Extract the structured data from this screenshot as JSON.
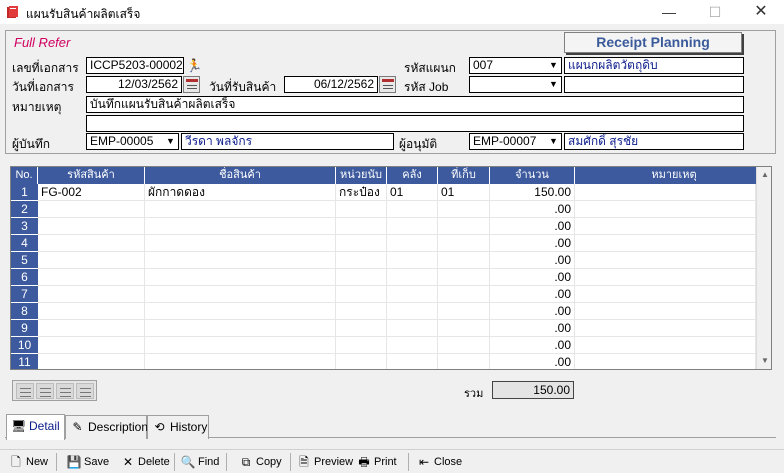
{
  "window": {
    "title": "แผนรับสินค้าผลิตเสร็จ"
  },
  "form": {
    "mode_label": "Full Refer",
    "planning_button": "Receipt Planning",
    "doc_no_label": "เลขที่เอกสาร",
    "doc_no": "ICCP5203-00002",
    "department_label": "รหัสแผนก",
    "department_code": "007",
    "department_name": "แผนกผลิตวัตถุดิบ",
    "doc_date_label": "วันที่เอกสาร",
    "doc_date": "12/03/2562",
    "receive_date_label": "วันที่รับสินค้า",
    "receive_date": "06/12/2562",
    "job_label": "รหัส Job",
    "job_code": "",
    "job_name": "",
    "remark_label": "หมายเหตุ",
    "remark_line1": "บันทึกแผนรับสินค้าผลิตเสร็จ",
    "remark_line2": "",
    "recorder_label": "ผู้บันทึก",
    "recorder_code": "EMP-00005",
    "recorder_name": "วีรดา พลจักร",
    "approver_label": "ผู้อนุมัติ",
    "approver_code": "EMP-00007",
    "approver_name": "สมศักดิ์ สุรชัย"
  },
  "grid": {
    "columns": [
      "No.",
      "รหัสสินค้า",
      "ชื่อสินค้า",
      "หน่วยนับ",
      "คลัง",
      "ที่เก็บ",
      "จำนวน",
      "หมายเหตุ"
    ],
    "rows": [
      {
        "no": "1",
        "code": "FG-002",
        "name": "ผักกาดดอง",
        "unit": "กระป๋อง",
        "wh": "01",
        "loc": "01",
        "qty": "150.00",
        "note": ""
      },
      {
        "no": "2",
        "code": "",
        "name": "",
        "unit": "",
        "wh": "",
        "loc": "",
        "qty": ".00",
        "note": ""
      },
      {
        "no": "3",
        "code": "",
        "name": "",
        "unit": "",
        "wh": "",
        "loc": "",
        "qty": ".00",
        "note": ""
      },
      {
        "no": "4",
        "code": "",
        "name": "",
        "unit": "",
        "wh": "",
        "loc": "",
        "qty": ".00",
        "note": ""
      },
      {
        "no": "5",
        "code": "",
        "name": "",
        "unit": "",
        "wh": "",
        "loc": "",
        "qty": ".00",
        "note": ""
      },
      {
        "no": "6",
        "code": "",
        "name": "",
        "unit": "",
        "wh": "",
        "loc": "",
        "qty": ".00",
        "note": ""
      },
      {
        "no": "7",
        "code": "",
        "name": "",
        "unit": "",
        "wh": "",
        "loc": "",
        "qty": ".00",
        "note": ""
      },
      {
        "no": "8",
        "code": "",
        "name": "",
        "unit": "",
        "wh": "",
        "loc": "",
        "qty": ".00",
        "note": ""
      },
      {
        "no": "9",
        "code": "",
        "name": "",
        "unit": "",
        "wh": "",
        "loc": "",
        "qty": ".00",
        "note": ""
      },
      {
        "no": "10",
        "code": "",
        "name": "",
        "unit": "",
        "wh": "",
        "loc": "",
        "qty": ".00",
        "note": ""
      },
      {
        "no": "11",
        "code": "",
        "name": "",
        "unit": "",
        "wh": "",
        "loc": "",
        "qty": ".00",
        "note": ""
      }
    ]
  },
  "summary": {
    "total_label": "รวม",
    "total": "150.00"
  },
  "tabs": [
    {
      "label": "Detail",
      "icon": "detail-icon"
    },
    {
      "label": "Description",
      "icon": "description-icon"
    },
    {
      "label": "History",
      "icon": "history-icon"
    }
  ],
  "toolbar": {
    "new": "New",
    "save": "Save",
    "delete": "Delete",
    "find": "Find",
    "copy": "Copy",
    "preview": "Preview",
    "print": "Print",
    "close": "Close"
  },
  "colors": {
    "header_blue": "#3d5a9e",
    "mode_pink": "#d00060",
    "plan_text": "#3a5a9a"
  }
}
